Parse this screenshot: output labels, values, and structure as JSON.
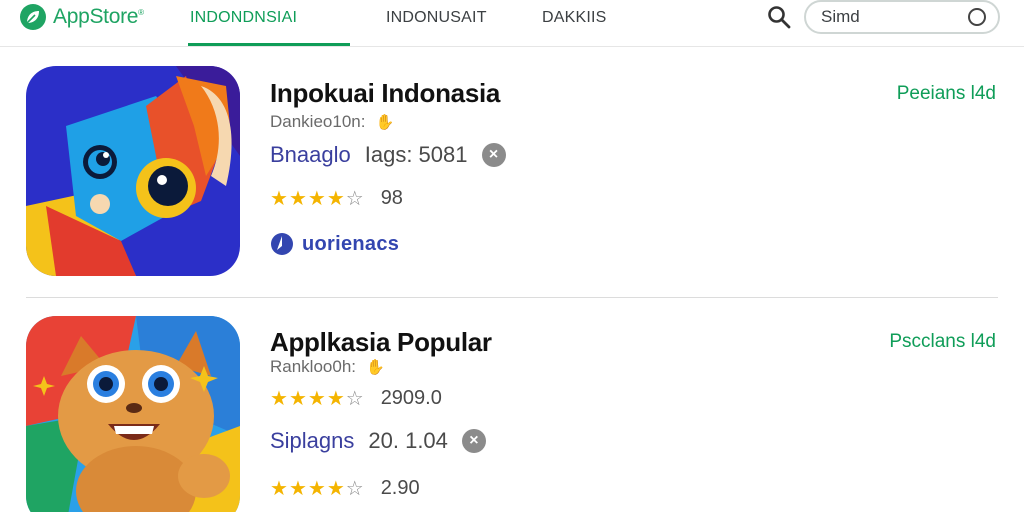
{
  "header": {
    "logo_text": "AppStore",
    "logo_mark": "®",
    "tabs": [
      {
        "label": "INDONDNSIAI",
        "active": true
      },
      {
        "label": "INDONUSAIT",
        "active": false
      },
      {
        "label": "DAKKIIS",
        "active": false
      }
    ],
    "search": {
      "value": "Simd",
      "icon": "search-icon",
      "clear_icon": "circle-icon"
    }
  },
  "colors": {
    "accent": "#0f9d58",
    "star": "#f4b400",
    "tag": "#3a3f9e",
    "brand": "#3346b0"
  },
  "apps": [
    {
      "title": "Inpokuai Indonasia",
      "subtitle": "Dankieo10n:",
      "subtitle_icon": "hand-icon",
      "price": "Peeians l4d",
      "tag_label": "Bnaaglo",
      "tag_value": "Iags:  5081",
      "rating": 4,
      "rating_value": "98",
      "brand_text": "uorienacs",
      "brand_icon": "badge-icon",
      "icon_art": "blue-fox-bird"
    },
    {
      "title": "Applkasia Popular",
      "subtitle": "Rankloo0h:",
      "subtitle_icon": "hand-icon",
      "price": "Pscclans l4d",
      "rating": 4,
      "rating_value": "2909.0",
      "tag_label": "Siplagns",
      "tag_value": "20.  1.04",
      "rating2": 4,
      "rating2_value": "2.90",
      "icon_art": "orange-cat"
    }
  ]
}
